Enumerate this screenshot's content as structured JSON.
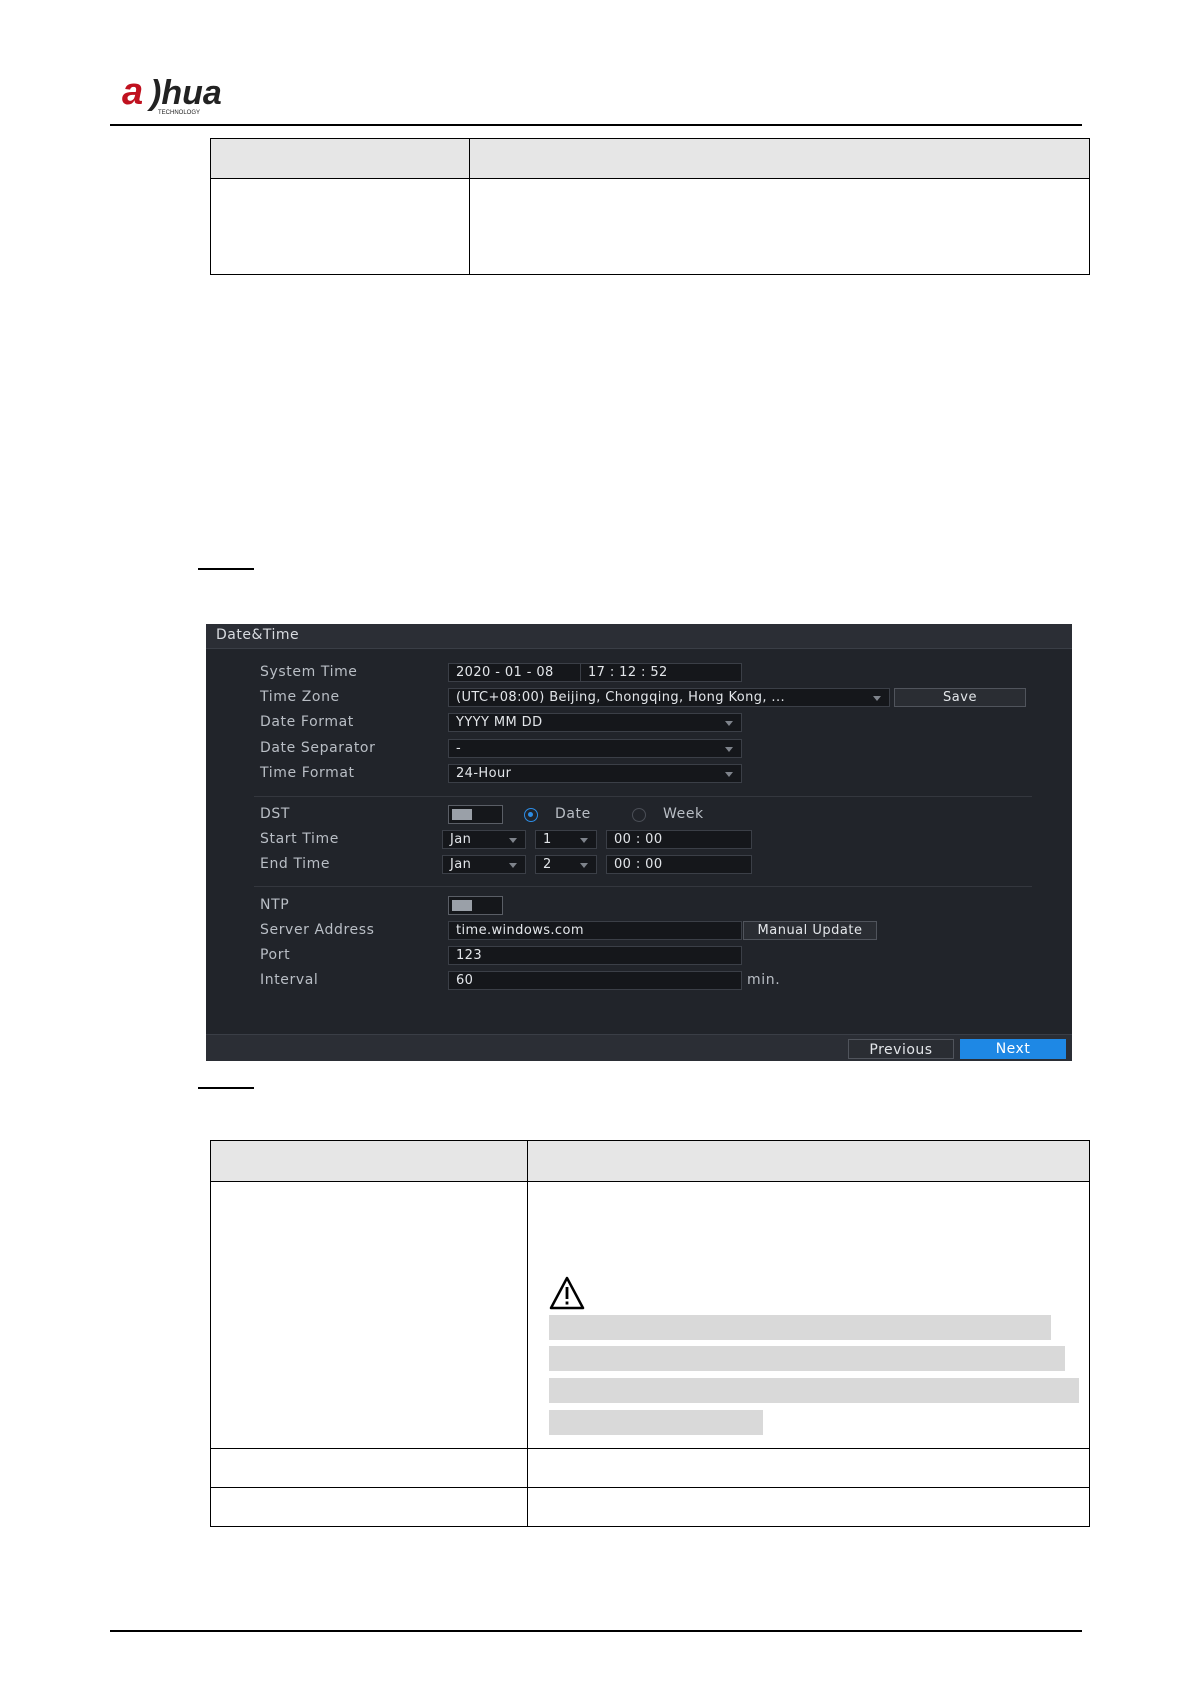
{
  "header": {
    "logo_text": "alhua",
    "logo_sub": "TECHNOLOGY"
  },
  "screenshot": {
    "title": "Date&Time",
    "system_time": {
      "label": "System Time",
      "date": "2020  - 01 - 08",
      "time": "17  : 12  : 52"
    },
    "time_zone": {
      "label": "Time Zone",
      "value": "(UTC+08:00) Beijing, Chongqing, Hong Kong, ...",
      "save_label": "Save"
    },
    "date_format": {
      "label": "Date Format",
      "value": "YYYY MM DD"
    },
    "date_separator": {
      "label": "Date Separator",
      "value": "-"
    },
    "time_format": {
      "label": "Time Format",
      "value": "24-Hour"
    },
    "dst": {
      "label": "DST",
      "enabled": false,
      "option_date": "Date",
      "option_week": "Week",
      "selected": "Date"
    },
    "start_time": {
      "label": "Start Time",
      "month": "Jan",
      "day": "1",
      "time": "00  : 00"
    },
    "end_time": {
      "label": "End Time",
      "month": "Jan",
      "day": "2",
      "time": "00  : 00"
    },
    "ntp": {
      "label": "NTP",
      "enabled": false
    },
    "server_address": {
      "label": "Server Address",
      "value": "time.windows.com",
      "update_label": "Manual Update"
    },
    "port": {
      "label": "Port",
      "value": "123"
    },
    "interval": {
      "label": "Interval",
      "value": "60",
      "unit": "min."
    },
    "footer": {
      "previous_label": "Previous",
      "next_label": "Next"
    },
    "colors": {
      "background": "#21242a",
      "accent": "#1e88e5"
    }
  }
}
